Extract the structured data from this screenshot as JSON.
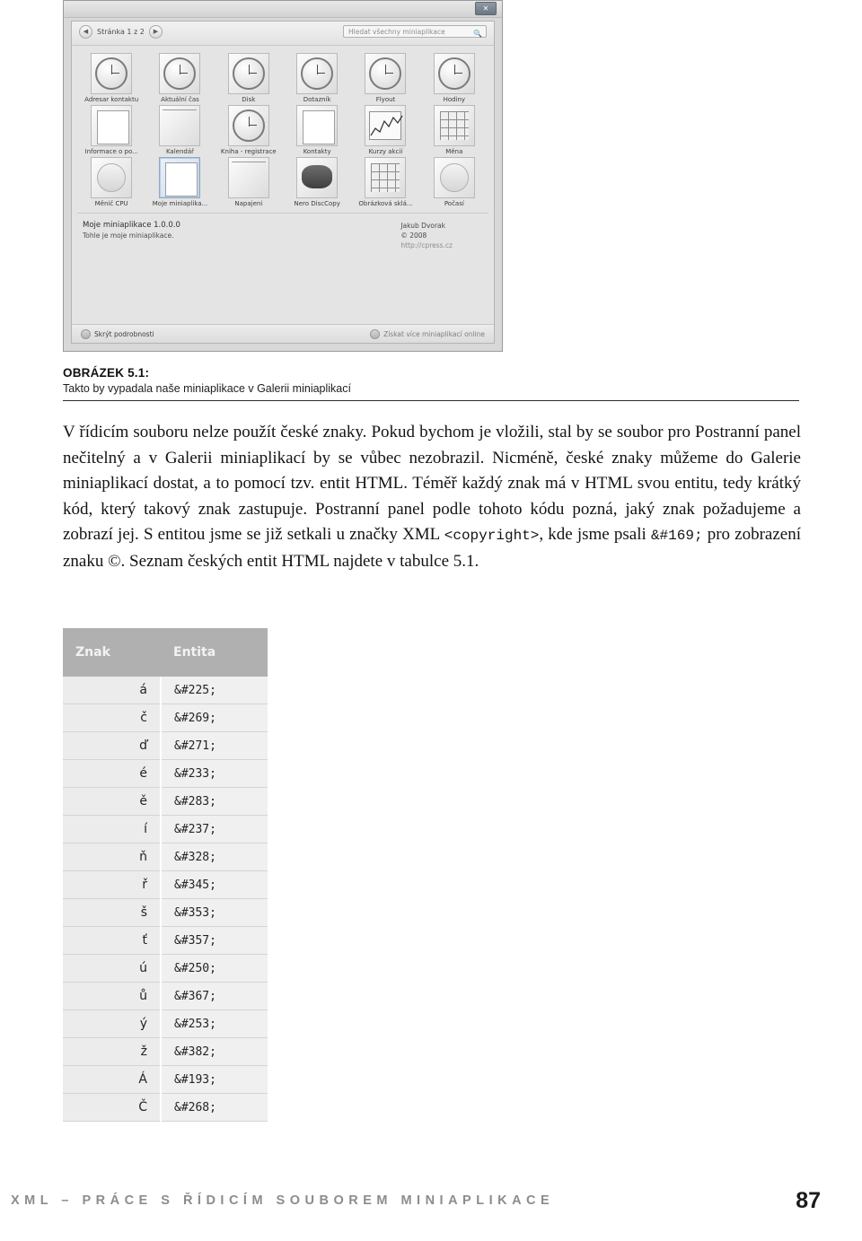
{
  "figure": {
    "title_close": "✕",
    "toolbar": {
      "prev_icon": "◀",
      "next_icon": "▶",
      "page_label": "Stránka 1 z 2",
      "search_placeholder": "Hledat všechny miniaplikace",
      "search_icon": "🔍"
    },
    "gadgets": [
      {
        "label": "Adresar kontaktu",
        "kind": "clock",
        "selected": false
      },
      {
        "label": "Aktuální čas",
        "kind": "clock",
        "selected": false
      },
      {
        "label": "Disk",
        "kind": "clock",
        "selected": false
      },
      {
        "label": "Dotazník",
        "kind": "clock",
        "selected": false
      },
      {
        "label": "Flyout",
        "kind": "clock",
        "selected": false
      },
      {
        "label": "Hodiny",
        "kind": "clock-big",
        "selected": false
      },
      {
        "label": "Informace o po...",
        "kind": "note",
        "selected": false
      },
      {
        "label": "Kalendář",
        "kind": "lines",
        "selected": false
      },
      {
        "label": "Kniha - registrace",
        "kind": "clock",
        "selected": false
      },
      {
        "label": "Kontakty",
        "kind": "note",
        "selected": false
      },
      {
        "label": "Kurzy akcií",
        "kind": "graph",
        "selected": false
      },
      {
        "label": "Měna",
        "kind": "grid",
        "selected": false
      },
      {
        "label": "Měnič CPU",
        "kind": "dark",
        "selected": false
      },
      {
        "label": "Moje miniaplika...",
        "kind": "note",
        "selected": true
      },
      {
        "label": "Napajeni",
        "kind": "lines",
        "selected": false
      },
      {
        "label": "Nero DiscCopy",
        "kind": "dark",
        "selected": false
      },
      {
        "label": "Obrázková sklá...",
        "kind": "grid",
        "selected": false
      },
      {
        "label": "Počasí",
        "kind": "circle",
        "selected": false
      }
    ],
    "details": {
      "name": "Moje miniaplikace 1.0.0.0",
      "description": "Tohle je moje miniaplikace.",
      "author": "Jakub Dvorak",
      "copyright": "© 2008",
      "url": "http://cpress.cz"
    },
    "status": {
      "hide_details": "Skrýt podrobnosti",
      "get_more": "Získat více miniaplikací online"
    }
  },
  "caption": {
    "label": "OBRÁZEK 5.1:",
    "text": "Takto by vypadala naše miniaplikace v Galerii miniaplikací"
  },
  "body": {
    "part1": "V řídicím souboru nelze použít české znaky.",
    "part2": " Pokud bychom je vložili, stal by se soubor pro Postranní panel nečitelný a v Galerii miniaplikací by se vůbec nezobrazil. Nicméně, české znaky můžeme do Galerie miniaplikací dostat, a to pomocí tzv. entit HTML. Téměř každý znak má v HTML svou entitu, tedy krátký kód, který takový znak zastupuje. Postranní panel podle tohoto kódu pozná, jaký znak požadujeme a zobrazí jej. S entitou jsme se již setkali u značky XML ",
    "code1": "<copyright>",
    "part3": ", kde jsme psali ",
    "code2": "&#169;",
    "part4": " pro zobrazení znaku ©. Seznam českých entit HTML najdete v tabulce 5.1."
  },
  "table": {
    "headers": [
      "Znak",
      "Entita"
    ],
    "rows": [
      [
        "á",
        "&#225;"
      ],
      [
        "č",
        "&#269;"
      ],
      [
        "ď",
        "&#271;"
      ],
      [
        "é",
        "&#233;"
      ],
      [
        "ě",
        "&#283;"
      ],
      [
        "í",
        "&#237;"
      ],
      [
        "ň",
        "&#328;"
      ],
      [
        "ř",
        "&#345;"
      ],
      [
        "š",
        "&#353;"
      ],
      [
        "ť",
        "&#357;"
      ],
      [
        "ú",
        "&#250;"
      ],
      [
        "ů",
        "&#367;"
      ],
      [
        "ý",
        "&#253;"
      ],
      [
        "ž",
        "&#382;"
      ],
      [
        "Á",
        "&#193;"
      ],
      [
        "Č",
        "&#268;"
      ]
    ]
  },
  "footer": {
    "running_head": "XML – PRÁCE S ŘÍDICÍM SOUBOREM MINIAPLIKACE",
    "page_number": "87"
  }
}
